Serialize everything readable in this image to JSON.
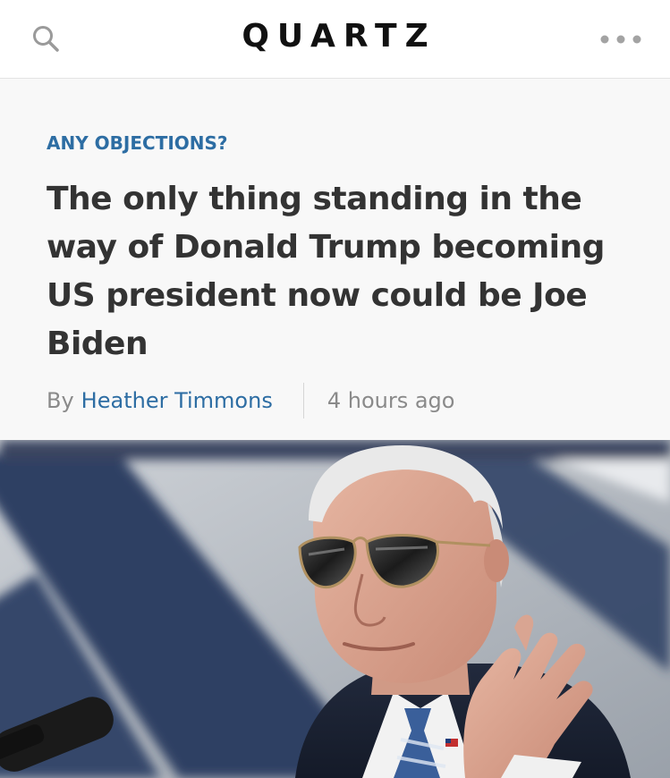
{
  "topbar": {
    "brand": "QUARTZ",
    "search_icon": "search-icon",
    "more_icon": "more-horizontal-icon"
  },
  "article": {
    "kicker": "ANY OBJECTIONS?",
    "headline": "The only thing standing in the way of Donald Trump becoming US president now could be Joe Biden",
    "byline_prefix": "By",
    "author": "Heather Timmons",
    "timestamp": "4 hours ago"
  },
  "colors": {
    "kicker": "#2d6da3",
    "author": "#2d6da3",
    "headline": "#333333",
    "meta": "#8a8a8a",
    "header_bg": "#f8f8f8"
  }
}
